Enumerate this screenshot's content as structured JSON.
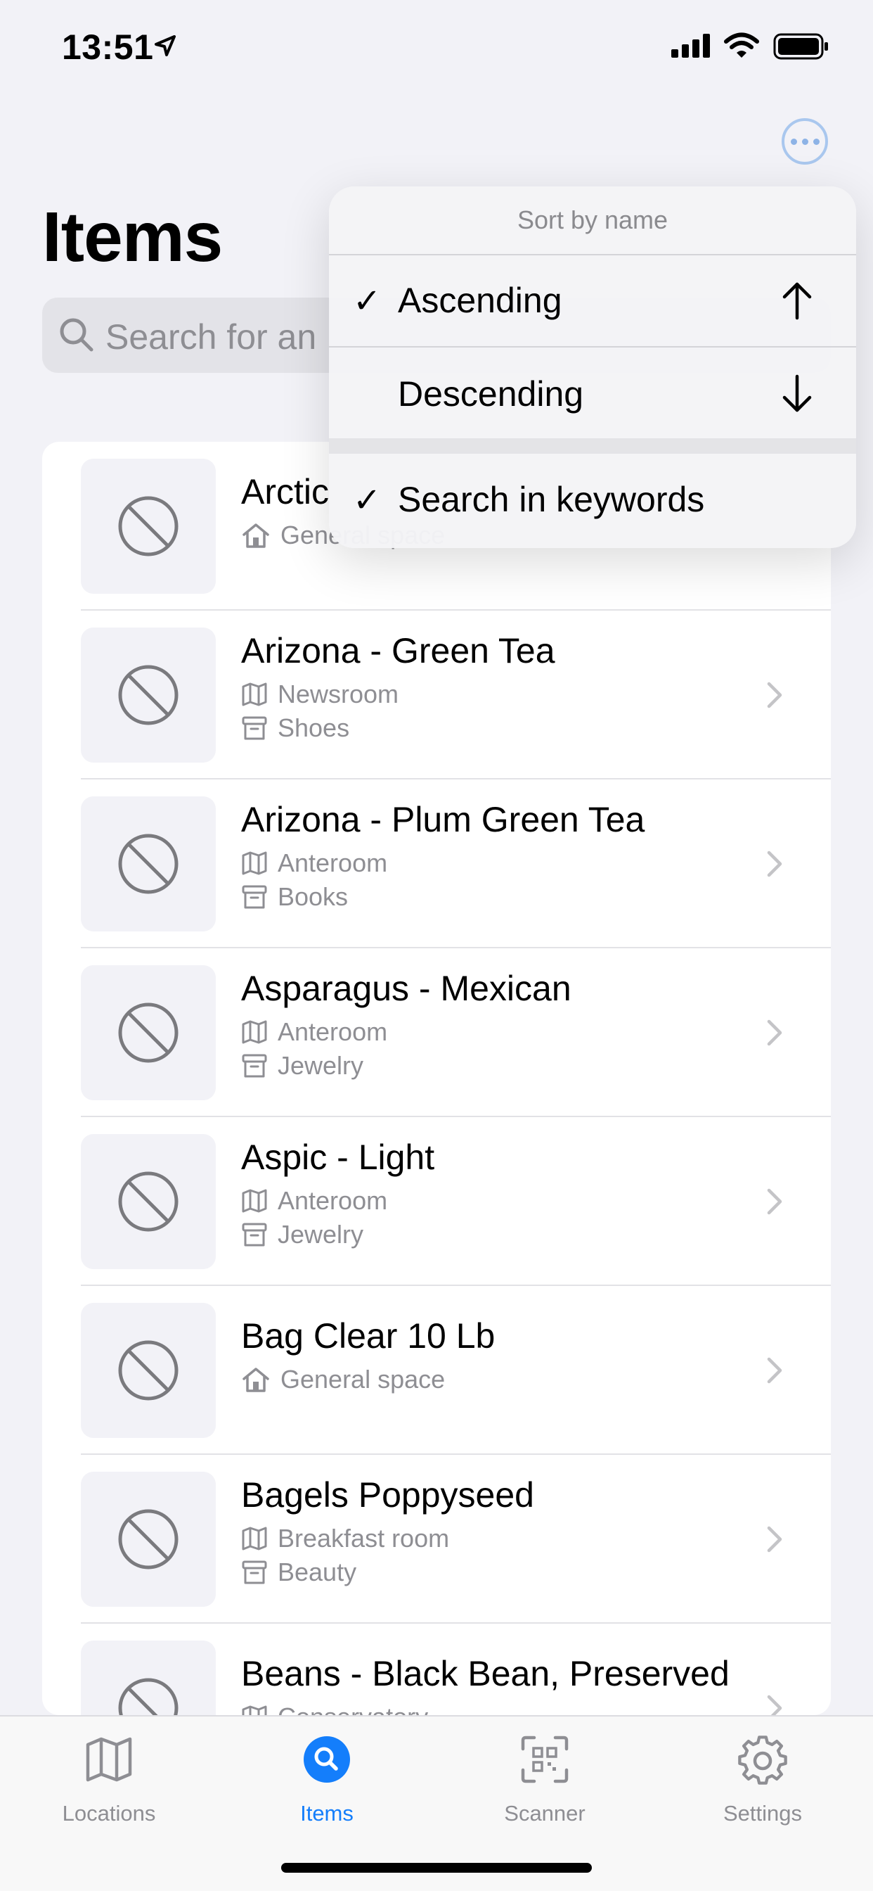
{
  "status_bar": {
    "time": "13:51"
  },
  "header": {
    "title": "Items",
    "more_icon": "ellipsis-circle-icon"
  },
  "search": {
    "placeholder": "Search for an"
  },
  "sort_menu": {
    "title": "Sort by name",
    "options": [
      {
        "label": "Ascending",
        "checked": true,
        "icon": "arrow-up-icon"
      },
      {
        "label": "Descending",
        "checked": false,
        "icon": "arrow-down-icon"
      }
    ],
    "keyword_option": {
      "label": "Search in keywords",
      "checked": true
    },
    "check_glyph": "✓"
  },
  "items": [
    {
      "name": "Arctic",
      "lines": [
        {
          "icon": "house-icon",
          "text": "General space"
        }
      ]
    },
    {
      "name": "Arizona - Green Tea",
      "lines": [
        {
          "icon": "map-icon",
          "text": "Newsroom"
        },
        {
          "icon": "box-icon",
          "text": "Shoes"
        }
      ]
    },
    {
      "name": "Arizona - Plum Green Tea",
      "lines": [
        {
          "icon": "map-icon",
          "text": "Anteroom"
        },
        {
          "icon": "box-icon",
          "text": "Books"
        }
      ]
    },
    {
      "name": "Asparagus - Mexican",
      "lines": [
        {
          "icon": "map-icon",
          "text": "Anteroom"
        },
        {
          "icon": "box-icon",
          "text": "Jewelry"
        }
      ]
    },
    {
      "name": "Aspic - Light",
      "lines": [
        {
          "icon": "map-icon",
          "text": "Anteroom"
        },
        {
          "icon": "box-icon",
          "text": "Jewelry"
        }
      ]
    },
    {
      "name": "Bag Clear 10 Lb",
      "lines": [
        {
          "icon": "house-icon",
          "text": "General space"
        }
      ]
    },
    {
      "name": "Bagels Poppyseed",
      "lines": [
        {
          "icon": "map-icon",
          "text": "Breakfast room"
        },
        {
          "icon": "box-icon",
          "text": "Beauty"
        }
      ]
    },
    {
      "name": "Beans - Black Bean, Preserved",
      "lines": [
        {
          "icon": "map-icon",
          "text": "Conservatory"
        }
      ]
    }
  ],
  "tabbar": {
    "tabs": [
      {
        "label": "Locations",
        "icon": "map-icon",
        "active": false
      },
      {
        "label": "Items",
        "icon": "search-icon",
        "active": true
      },
      {
        "label": "Scanner",
        "icon": "qr-scanner-icon",
        "active": false
      },
      {
        "label": "Settings",
        "icon": "gear-icon",
        "active": false
      }
    ]
  },
  "colors": {
    "accent": "#147efb",
    "secondary_text": "#8e8e93",
    "background": "#f2f2f7"
  }
}
